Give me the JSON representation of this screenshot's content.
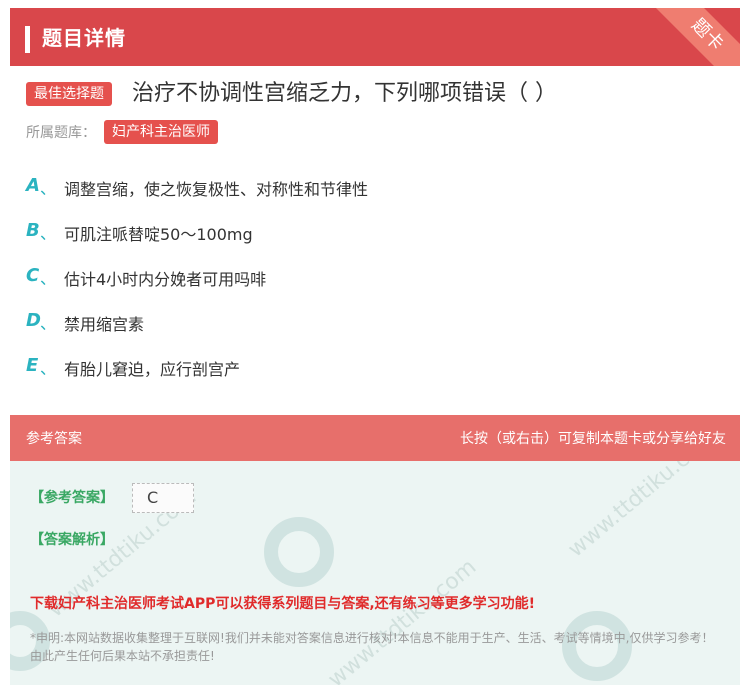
{
  "header": {
    "title": "题目详情",
    "ribbon": "题卡"
  },
  "question": {
    "tag": "最佳选择题",
    "text": "治疗不协调性宫缩乏力，下列哪项错误（  ）",
    "category_label": "所属题库：",
    "category": "妇产科主治医师"
  },
  "options": [
    {
      "letter": "A",
      "sep": "、",
      "text": "调整宫缩，使之恢复极性、对称性和节律性"
    },
    {
      "letter": "B",
      "sep": "、",
      "text": "可肌注哌替啶50～100mg"
    },
    {
      "letter": "C",
      "sep": "、",
      "text": "估计4小时内分娩者可用吗啡"
    },
    {
      "letter": "D",
      "sep": "、",
      "text": "禁用缩宫素"
    },
    {
      "letter": "E",
      "sep": "、",
      "text": "有胎儿窘迫，应行剖宫产"
    }
  ],
  "answer_section": {
    "title": "参考答案",
    "hint": "长按（或右击）可复制本题卡或分享给好友",
    "answer_label": "【参考答案】",
    "answer_value": "C",
    "analysis_label": "【答案解析】",
    "promo": "下载妇产科主治医师考试APP可以获得系列题目与答案,还有练习等更多学习功能!",
    "disclaimer": "*申明:本网站数据收集整理于互联网!我们并未能对答案信息进行核对!本信息不能用于生产、生活、考试等情境中,仅供学习参考！由此产生任何后果本站不承担责任!"
  },
  "colors": {
    "header_bg": "#d9474b",
    "accent_red": "#e5514d",
    "option_letter": "#2bb3c0",
    "answer_label": "#3aa864",
    "promo": "#e02b2b"
  }
}
